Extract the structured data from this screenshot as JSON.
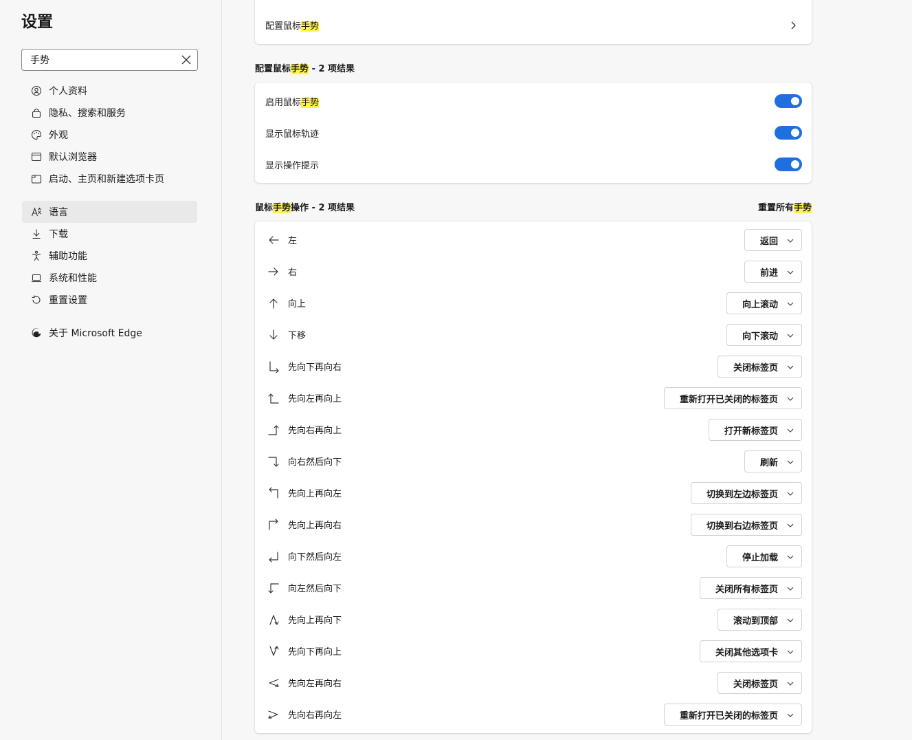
{
  "sidebar": {
    "title": "设置",
    "search": {
      "value": "手势",
      "placeholder": ""
    },
    "items": [
      {
        "label": "个人资料",
        "icon": "profile-icon"
      },
      {
        "label": "隐私、搜索和服务",
        "icon": "lock-icon"
      },
      {
        "label": "外观",
        "icon": "palette-icon"
      },
      {
        "label": "默认浏览器",
        "icon": "browser-icon"
      },
      {
        "label": "启动、主页和新建选项卡页",
        "icon": "power-icon"
      },
      {
        "label": "语言",
        "icon": "language-icon",
        "active": true
      },
      {
        "label": "下载",
        "icon": "download-icon"
      },
      {
        "label": "辅助功能",
        "icon": "accessibility-icon"
      },
      {
        "label": "系统和性能",
        "icon": "laptop-icon"
      },
      {
        "label": "重置设置",
        "icon": "reset-icon"
      },
      {
        "label": "关于 Microsoft Edge",
        "icon": "edge-icon"
      }
    ]
  },
  "top_card": {
    "label_prefix": "配置鼠标",
    "label_highlight": "手势"
  },
  "configure_section": {
    "heading_prefix": "配置鼠标",
    "heading_highlight": "手势",
    "heading_suffix": " - 2 项结果",
    "rows": [
      {
        "prefix": "启用鼠标",
        "highlight": "手势",
        "enabled": true
      },
      {
        "prefix": "显示鼠标轨迹",
        "highlight": "",
        "enabled": true
      },
      {
        "prefix": "显示操作提示",
        "highlight": "",
        "enabled": true
      }
    ]
  },
  "actions_section": {
    "heading_prefix": "鼠标",
    "heading_highlight": "手势",
    "heading_suffix": "操作 - 2 项结果",
    "reset_prefix": "重置所有",
    "reset_highlight": "手势",
    "gestures": [
      {
        "label": "左",
        "action": "返回",
        "icon": "arrow-left-icon"
      },
      {
        "label": "右",
        "action": "前进",
        "icon": "arrow-right-icon"
      },
      {
        "label": "向上",
        "action": "向上滚动",
        "icon": "arrow-up-icon"
      },
      {
        "label": "下移",
        "action": "向下滚动",
        "icon": "arrow-down-icon"
      },
      {
        "label": "先向下再向右",
        "action": "关闭标签页",
        "icon": "gesture-down-right-icon"
      },
      {
        "label": "先向左再向上",
        "action": "重新打开已关闭的标签页",
        "icon": "gesture-left-up-icon"
      },
      {
        "label": "先向右再向上",
        "action": "打开新标签页",
        "icon": "gesture-right-up-icon"
      },
      {
        "label": "向右然后向下",
        "action": "刷新",
        "icon": "gesture-right-down-icon"
      },
      {
        "label": "先向上再向左",
        "action": "切换到左边标签页",
        "icon": "gesture-up-left-icon"
      },
      {
        "label": "先向上再向右",
        "action": "切换到右边标签页",
        "icon": "gesture-up-right-icon"
      },
      {
        "label": "向下然后向左",
        "action": "停止加载",
        "icon": "gesture-down-left-icon"
      },
      {
        "label": "向左然后向下",
        "action": "关闭所有标签页",
        "icon": "gesture-left-down-icon"
      },
      {
        "label": "先向上再向下",
        "action": "滚动到顶部",
        "icon": "gesture-up-down-icon"
      },
      {
        "label": "先向下再向上",
        "action": "关闭其他选项卡",
        "icon": "gesture-down-up-icon"
      },
      {
        "label": "先向左再向右",
        "action": "关闭标签页",
        "icon": "gesture-left-right-icon"
      },
      {
        "label": "先向右再向左",
        "action": "重新打开已关闭的标签页",
        "icon": "gesture-right-left-icon"
      }
    ]
  },
  "colors": {
    "accent": "#1f6fe0",
    "highlight": "#fff34a"
  }
}
